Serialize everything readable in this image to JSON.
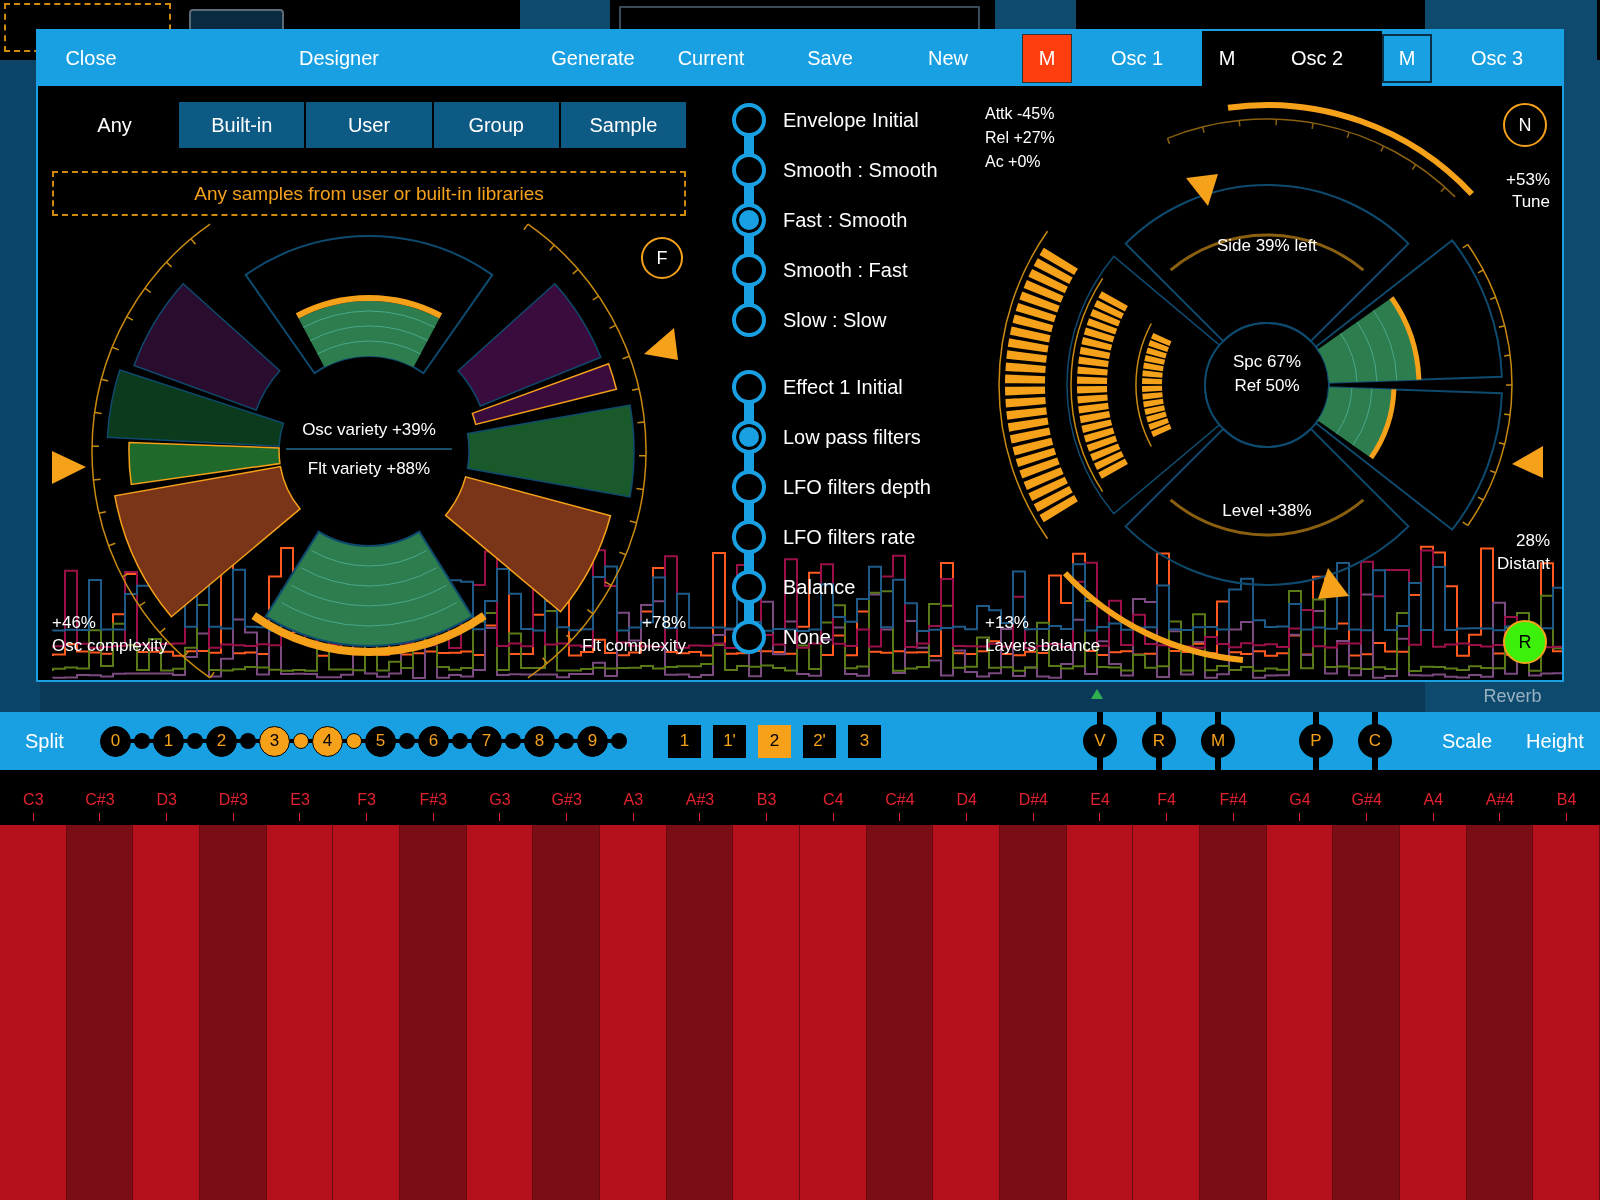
{
  "background": {
    "side_label": "Reverb"
  },
  "dialog": {
    "header_buttons": [
      "Close",
      "Designer",
      "Generate",
      "Current",
      "Save",
      "New"
    ],
    "oscillators": [
      {
        "mute_label": "M",
        "label": "Osc 1",
        "muted": true,
        "outlined": false,
        "selected": false
      },
      {
        "mute_label": "M",
        "label": "Osc 2",
        "muted": false,
        "outlined": false,
        "selected": true
      },
      {
        "mute_label": "M",
        "label": "Osc 3",
        "muted": false,
        "outlined": true,
        "selected": false
      }
    ]
  },
  "source_tabs": [
    {
      "label": "Any",
      "selected": true
    },
    {
      "label": "Built-in",
      "selected": false
    },
    {
      "label": "User",
      "selected": false
    },
    {
      "label": "Group",
      "selected": false
    },
    {
      "label": "Sample",
      "selected": false
    }
  ],
  "source_hint": "Any samples from user or built-in libraries",
  "variety": {
    "osc_variety": "Osc variety +39%",
    "flt_variety": "Flt variety +88%",
    "osc_complexity_value": "+46%",
    "osc_complexity_label": "Osc complexity",
    "flt_complexity_value": "+78%",
    "flt_complexity_label": "Flt complexity",
    "f_button": "F"
  },
  "option_groups": [
    {
      "items": [
        {
          "label": "Envelope Initial",
          "selected": false
        },
        {
          "label": "Smooth : Smooth",
          "selected": false
        },
        {
          "label": "Fast : Smooth",
          "selected": true
        },
        {
          "label": "Smooth : Fast",
          "selected": false
        },
        {
          "label": "Slow : Slow",
          "selected": false
        }
      ]
    },
    {
      "items": [
        {
          "label": "Effect 1 Initial",
          "selected": false
        },
        {
          "label": "Low pass filters",
          "selected": true
        },
        {
          "label": "LFO filters depth",
          "selected": false
        },
        {
          "label": "LFO filters rate",
          "selected": false
        },
        {
          "label": "Balance",
          "selected": false
        },
        {
          "label": "None",
          "selected": false
        }
      ]
    }
  ],
  "spatial": {
    "envelope_readouts": [
      "Attk -45%",
      "Rel +27%",
      "Ac +0%"
    ],
    "n_button": "N",
    "tune_value": "+53%",
    "tune_label": "Tune",
    "side": "Side 39% left",
    "spc": "Spc 67%",
    "ref": "Ref 50%",
    "level": "Level +38%",
    "distant_value": "28%",
    "distant_label": "Distant",
    "reverb_button": {
      "label": "R",
      "on": true
    },
    "layers_value": "+13%",
    "layers_label": "Layers balance"
  },
  "bottom_bar": {
    "split_label": "Split",
    "split_points": [
      {
        "label": "0",
        "selected": false
      },
      {
        "label": "1",
        "selected": false
      },
      {
        "label": "2",
        "selected": false
      },
      {
        "label": "3",
        "selected": true
      },
      {
        "label": "4",
        "selected": true
      },
      {
        "label": "5",
        "selected": false
      },
      {
        "label": "6",
        "selected": false
      },
      {
        "label": "7",
        "selected": false
      },
      {
        "label": "8",
        "selected": false
      },
      {
        "label": "9",
        "selected": false
      }
    ],
    "layers": [
      {
        "label": "1",
        "selected": false
      },
      {
        "label": "1'",
        "selected": false
      },
      {
        "label": "2",
        "selected": true
      },
      {
        "label": "2'",
        "selected": false
      },
      {
        "label": "3",
        "selected": false
      }
    ],
    "modifiers": [
      "V",
      "R",
      "M",
      "P",
      "C"
    ],
    "scale": "Scale",
    "height": "Height"
  },
  "keyboard": [
    {
      "note": "C3",
      "kind": "natural"
    },
    {
      "note": "C#3",
      "kind": "sharp"
    },
    {
      "note": "D3",
      "kind": "natural"
    },
    {
      "note": "D#3",
      "kind": "sharp"
    },
    {
      "note": "E3",
      "kind": "natural"
    },
    {
      "note": "F3",
      "kind": "natural"
    },
    {
      "note": "F#3",
      "kind": "sharp"
    },
    {
      "note": "G3",
      "kind": "natural"
    },
    {
      "note": "G#3",
      "kind": "sharp"
    },
    {
      "note": "A3",
      "kind": "natural"
    },
    {
      "note": "A#3",
      "kind": "sharp"
    },
    {
      "note": "B3",
      "kind": "natural"
    },
    {
      "note": "C4",
      "kind": "natural"
    },
    {
      "note": "C#4",
      "kind": "sharp"
    },
    {
      "note": "D4",
      "kind": "natural"
    },
    {
      "note": "D#4",
      "kind": "sharp"
    },
    {
      "note": "E4",
      "kind": "natural"
    },
    {
      "note": "F4",
      "kind": "natural"
    },
    {
      "note": "F#4",
      "kind": "sharp"
    },
    {
      "note": "G4",
      "kind": "natural"
    },
    {
      "note": "G#4",
      "kind": "sharp"
    },
    {
      "note": "A4",
      "kind": "natural"
    },
    {
      "note": "A#4",
      "kind": "sharp"
    },
    {
      "note": "B4",
      "kind": "natural"
    }
  ]
}
